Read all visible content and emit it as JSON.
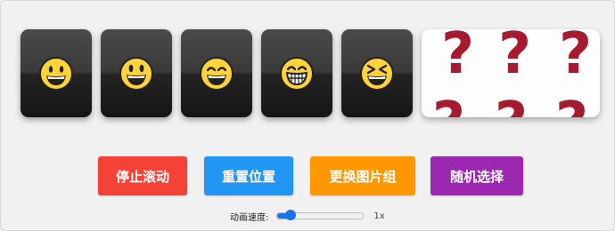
{
  "emoji_cards": [
    {
      "icon": "grinning-face-icon"
    },
    {
      "icon": "smiley-face-icon"
    },
    {
      "icon": "grin-smiling-eyes-icon"
    },
    {
      "icon": "grimacing-teeth-face-icon"
    },
    {
      "icon": "squinting-laughing-face-icon"
    }
  ],
  "question_card": {
    "glyph": "?",
    "color": "#a51c30"
  },
  "buttons": {
    "stop": {
      "label": "停止滚动",
      "color": "#f44336"
    },
    "reset": {
      "label": "重置位置",
      "color": "#2196f3"
    },
    "switch_group": {
      "label": "更换图片组",
      "color": "#ff9800"
    },
    "random": {
      "label": "随机选择",
      "color": "#9c27b0"
    }
  },
  "speed": {
    "label": "动画速度:",
    "value": "1x",
    "fraction": 0.15,
    "accent": "#1a73e8"
  }
}
